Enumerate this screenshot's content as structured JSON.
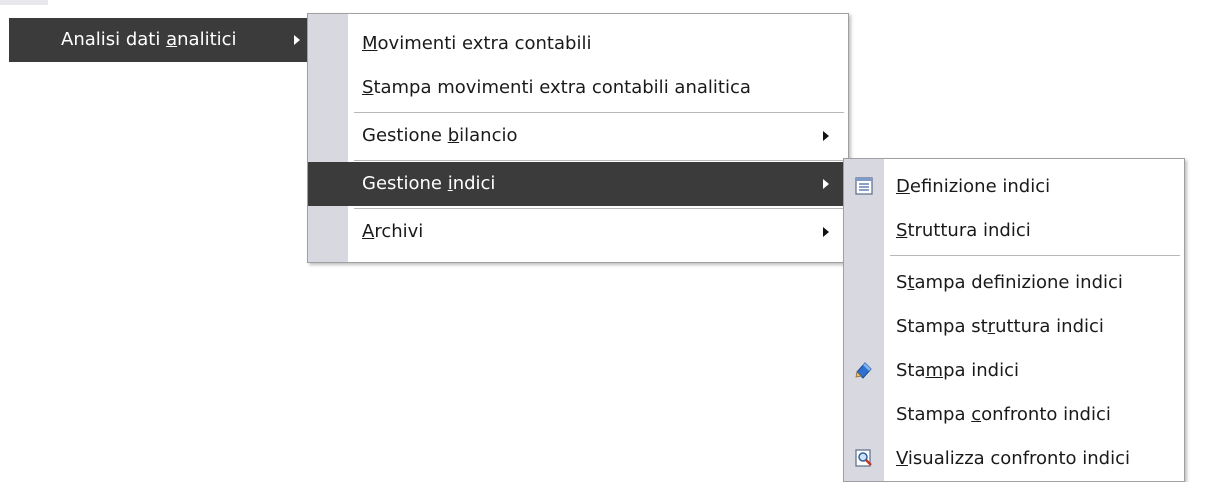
{
  "parent_item": {
    "label_pre": "Analisi dati ",
    "label_key": "a",
    "label_post": "nalitici"
  },
  "submenu1": {
    "items": [
      {
        "pre": "",
        "key": "M",
        "post": "ovimenti extra contabili"
      },
      {
        "pre": "",
        "key": "S",
        "post": "tampa movimenti extra contabili analitica"
      },
      {
        "pre": "Gestione ",
        "key": "b",
        "post": "ilancio"
      },
      {
        "pre": "Gestione ",
        "key": "i",
        "post": "ndici"
      },
      {
        "pre": "",
        "key": "A",
        "post": "rchivi"
      }
    ]
  },
  "submenu2": {
    "items": [
      {
        "pre": "",
        "key": "D",
        "post": "efinizione indici",
        "icon": "list-document-icon"
      },
      {
        "pre": "",
        "key": "S",
        "post": "truttura indici"
      },
      {
        "pre": "S",
        "key": "t",
        "post": "ampa definizione indici"
      },
      {
        "pre": "Stampa st",
        "key": "r",
        "post": "uttura indici"
      },
      {
        "pre": "Sta",
        "key": "m",
        "post": "pa indici",
        "icon": "print-pencil-icon"
      },
      {
        "pre": "Stampa ",
        "key": "c",
        "post": "onfronto indici"
      },
      {
        "pre": "",
        "key": "V",
        "post": "isualizza confronto indici",
        "icon": "magnifier-document-icon"
      }
    ]
  },
  "colors": {
    "selected_bg": "#3b3b3b",
    "gutter": "#d8d8e0",
    "border": "#a0a0a0"
  }
}
